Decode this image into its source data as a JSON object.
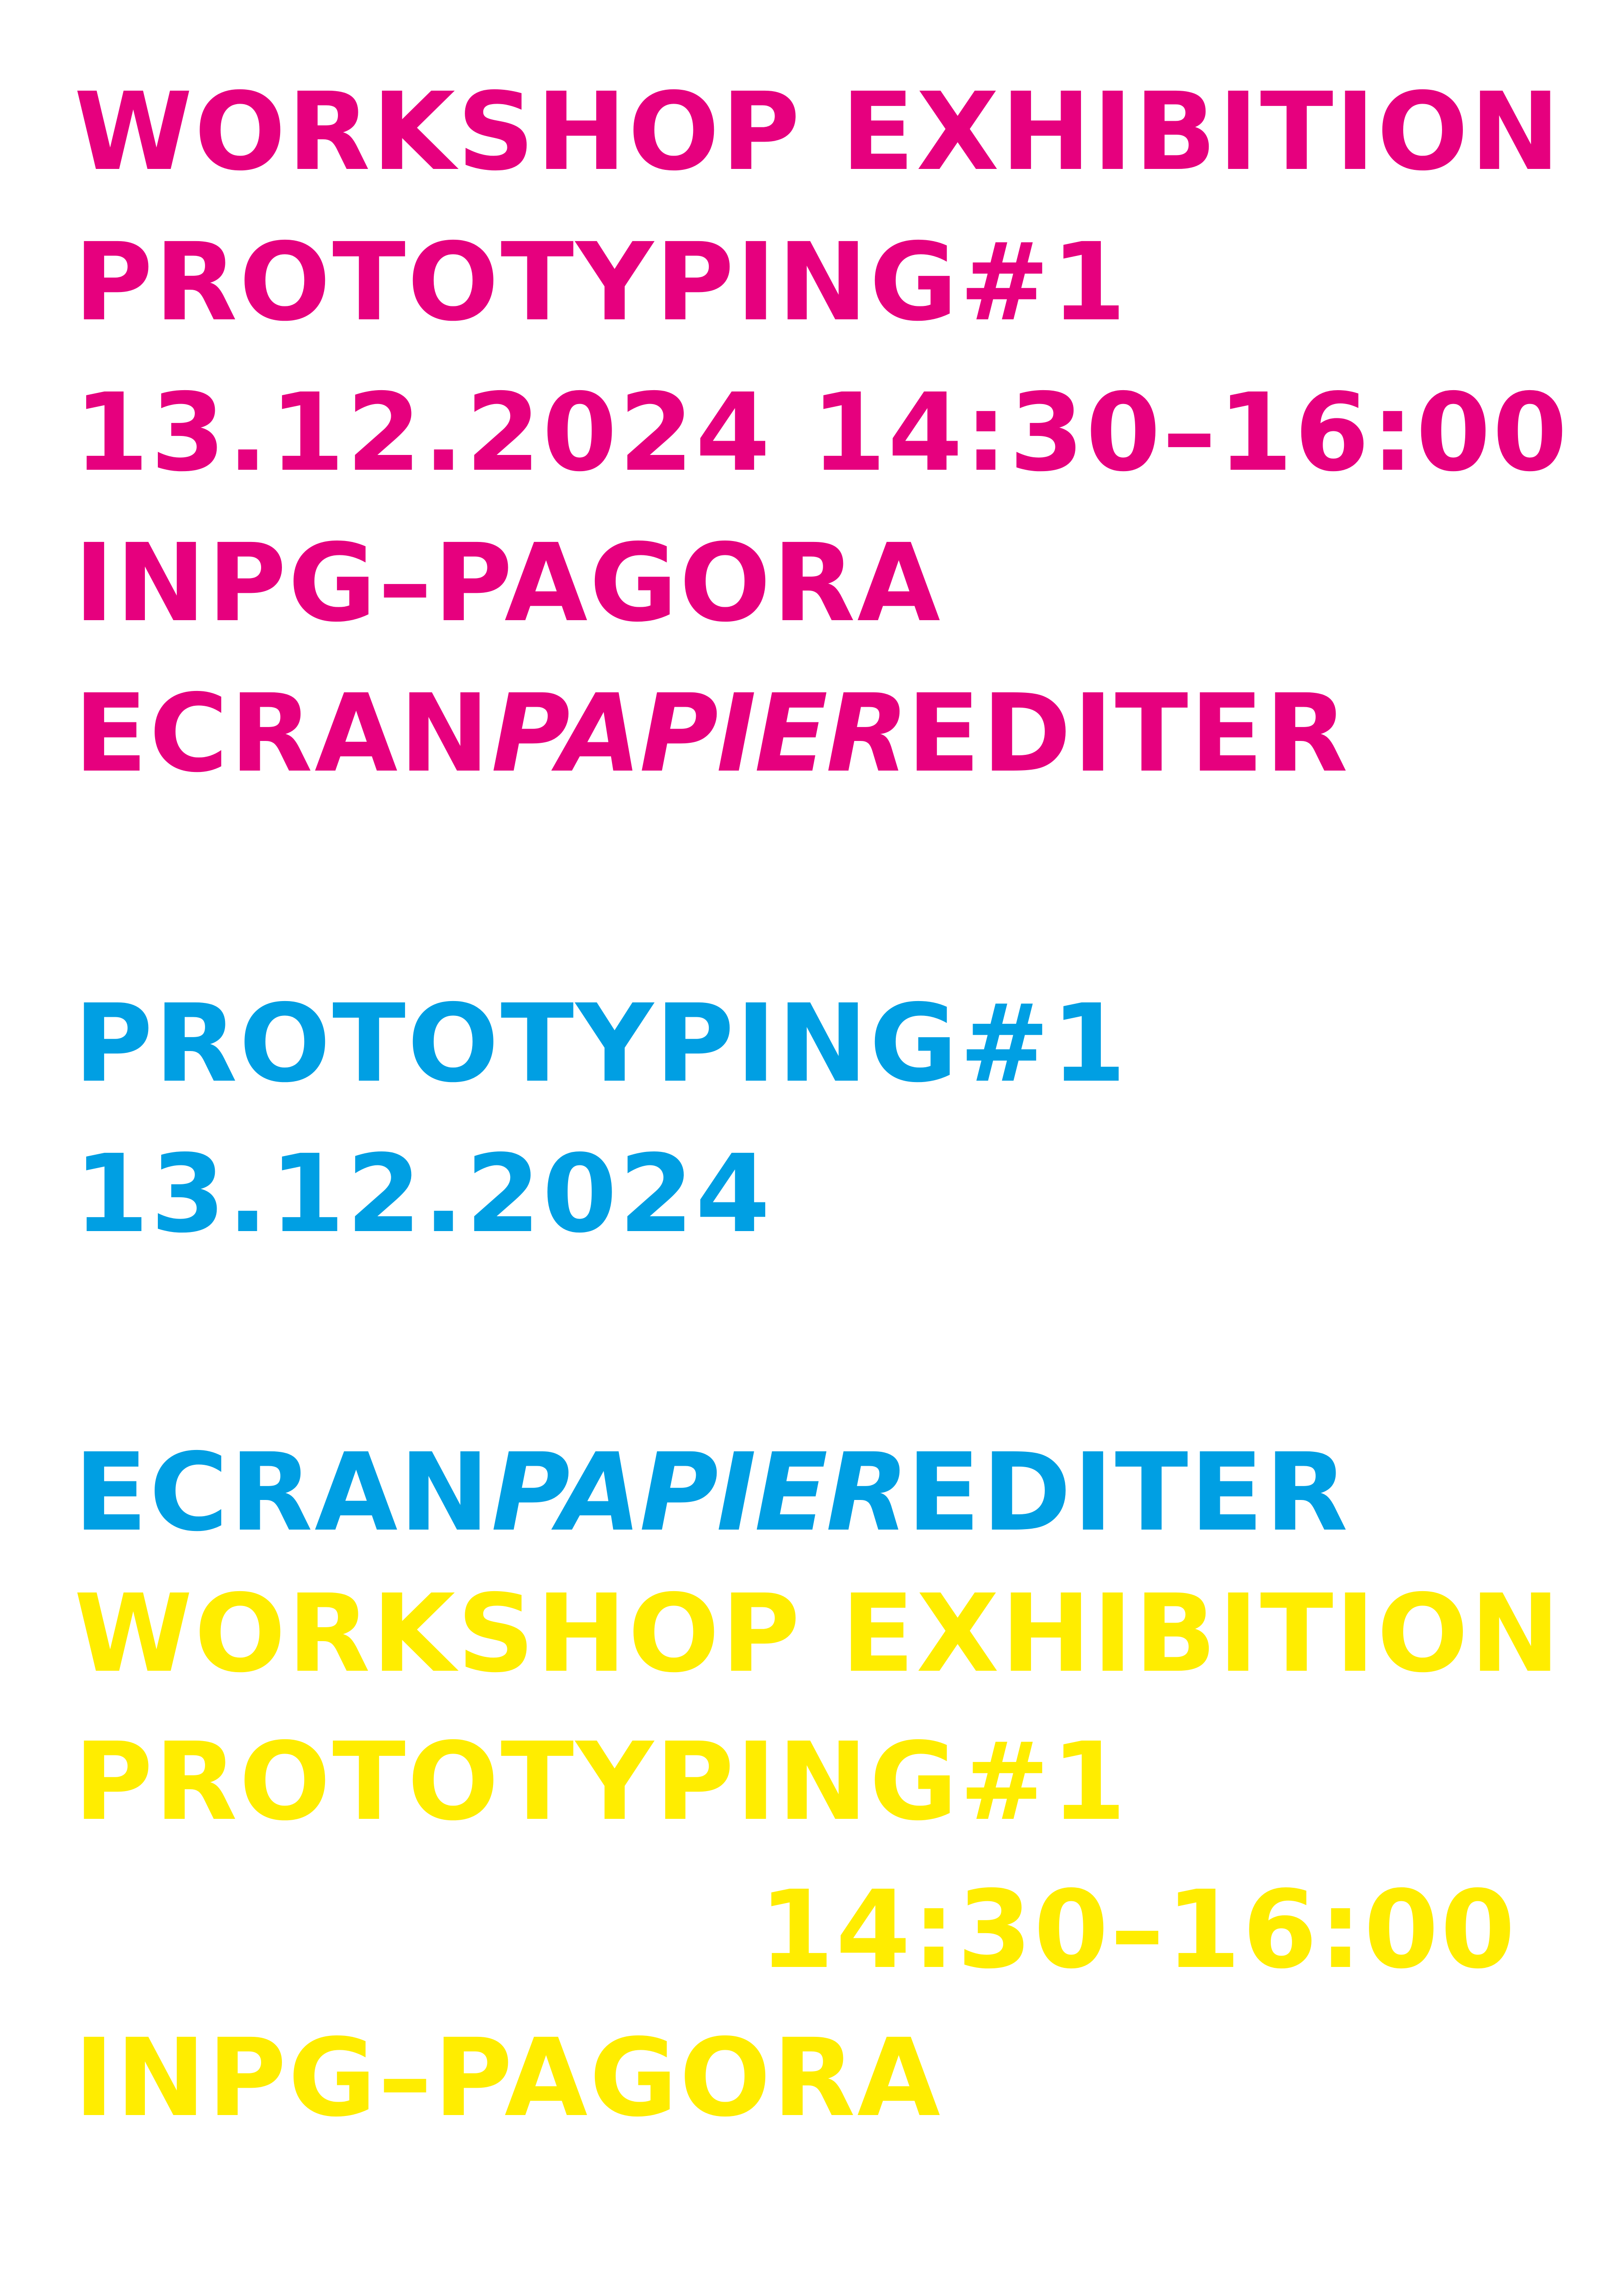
{
  "colors": {
    "magenta": "#e6007e",
    "cyan": "#009fe3",
    "yellow": "#ffed00",
    "background": "#ffffff"
  },
  "block_magenta": {
    "line1": "WORKSHOP EXHIBITION",
    "line2": "PROTOTYPING#1",
    "line3": "13.12.2024 14:30–16:00",
    "line4": "INPG–PAGORA",
    "line5_a": "ECRAN",
    "line5_b": "PAPIER",
    "line5_c": "EDITER"
  },
  "block_cyan": {
    "line1": "PROTOTYPING#1",
    "line2": "13.12.2024",
    "line3_a": "ECRAN",
    "line3_b": "PAPIER",
    "line3_c": "EDITER"
  },
  "block_yellow": {
    "line1": "WORKSHOP EXHIBITION",
    "line2": "PROTOTYPING#1",
    "line3": "14:30–16:00",
    "line4": "INPG–PAGORA"
  }
}
